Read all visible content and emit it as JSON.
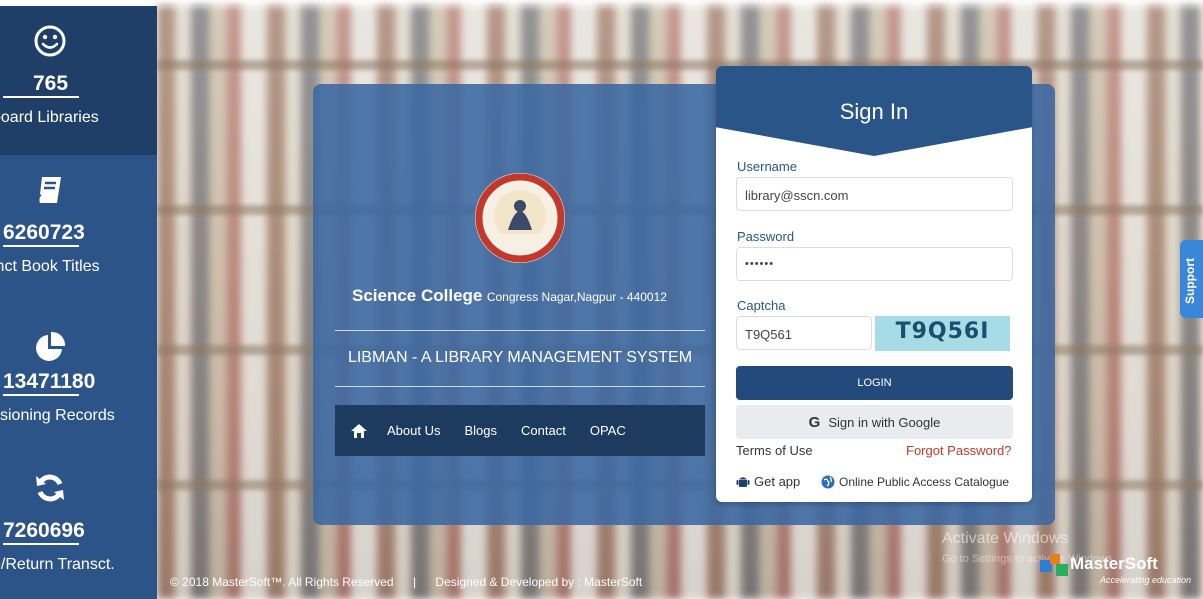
{
  "stats": [
    {
      "icon": "smiley-icon",
      "count": "765",
      "label": "board Libraries"
    },
    {
      "icon": "book-icon",
      "count": "6260723",
      "label": "inct Book Titles"
    },
    {
      "icon": "pie-chart-icon",
      "count": "13471180",
      "label": "ssioning Records"
    },
    {
      "icon": "refresh-icon",
      "count": "7260696",
      "label": "e/Return Transct."
    }
  ],
  "college": {
    "name": "Science College",
    "address": "Congress Nagar,Nagpur - 440012",
    "system_title": "LIBMAN - A LIBRARY MANAGEMENT SYSTEM"
  },
  "nav": {
    "home_icon": "home-icon",
    "links": [
      "About Us",
      "Blogs",
      "Contact",
      "OPAC"
    ]
  },
  "signin": {
    "title": "Sign In",
    "username_label": "Username",
    "username_value": "library@sscn.com",
    "password_label": "Password",
    "password_value": "••••••",
    "captcha_label": "Captcha",
    "captcha_value": "T9Q561",
    "captcha_image_text": "T9Q56I",
    "login_label": "LOGIN",
    "google_label": "Sign in with Google",
    "terms_label": "Terms of Use",
    "forgot_label": "Forgot Password?",
    "getapp_label": "Get app",
    "opac_label": "Online Public Access Catalogue"
  },
  "support_label": "Support",
  "footer": {
    "copyright": "© 2018 MasterSoft™. All Rights Reserved",
    "separator": "|",
    "designed_by": "Designed & Developed by : MasterSoft"
  },
  "windows_watermark": {
    "line1": "Activate Windows",
    "line2": "Go to Settings to activate Windows."
  },
  "brand": {
    "name": "MasterSoft",
    "tagline": "Accelerating education"
  },
  "colors": {
    "stat_dark": "#1f3f68",
    "stat_mid": "#2c5489",
    "card": "#3a68a2",
    "signin_header": "#2a5588",
    "login_button": "#234a7a",
    "forgot_link": "#c0392b",
    "support_tab": "#3a86d8"
  }
}
